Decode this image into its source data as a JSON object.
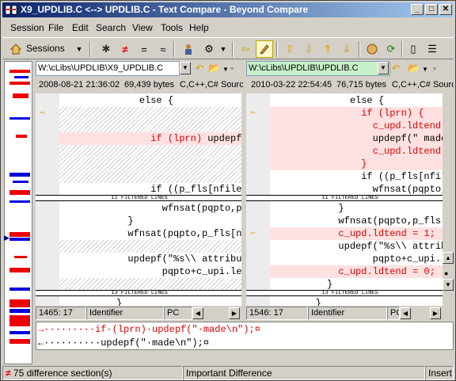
{
  "window": {
    "title": "X9_UPDLIB.C <--> UPDLIB.C - Text Compare - Beyond Compare",
    "minimize": "_",
    "maximize": "□",
    "close": "✕"
  },
  "menu": [
    "Session",
    "File",
    "Edit",
    "Search",
    "View",
    "Tools",
    "Help"
  ],
  "toolbar": {
    "sessions_label": "Sessions",
    "icons": [
      "home-icon",
      "all-icon",
      "diffs-icon",
      "same-icon",
      "context-icon",
      "rules-icon",
      "next-icon",
      "edit-icon",
      "prev-diff-icon",
      "next-diff-icon",
      "swap-icon",
      "reload-icon",
      "minor-icon",
      "report-icon"
    ]
  },
  "left": {
    "path": "W:\\cLibs\\UPDLIB\\X9_UPDLIB.C",
    "date": "2008-08-21 21:36:02",
    "size": "69,439 bytes",
    "format": "C,C++,C# Source",
    "lines": [
      {
        "text": "              else {",
        "style": ""
      },
      {
        "text": "",
        "style": "hatch"
      },
      {
        "text": "",
        "style": "hatch"
      },
      {
        "text": "                if (lprn) updepf(\" made\\n\");",
        "style": "pink"
      },
      {
        "text": "",
        "style": "hatch"
      },
      {
        "text": "",
        "style": "hatch"
      },
      {
        "text": "",
        "style": "hatch"
      },
      {
        "text": "                if ((p_fls[nfile].iattribute",
        "style": ""
      },
      {
        "text": "                  wfnsat(pqpto,p_fls[nfile].",
        "style": ""
      },
      {
        "text": "            }",
        "style": ""
      },
      {
        "text": "            wfnsat(pqpto,p_fls[nfile]",
        "style": ""
      },
      {
        "text": "",
        "style": "hatch"
      },
      {
        "text": "            updepf(\"%s\\\\ attribute",
        "style": ""
      },
      {
        "text": "                  pqpto+c_upi.len",
        "style": ""
      },
      {
        "text": "",
        "style": "hatch"
      },
      {
        "text": "          }",
        "style": ""
      },
      {
        "text": "        }",
        "style": ""
      }
    ],
    "filtered": [
      "11 FILTERED LINES",
      "13 FILTERED LINES"
    ],
    "status_pos": "1465: 17",
    "status_kind": "Identifier",
    "status_pc": "PC"
  },
  "right": {
    "path": "W:\\cLibs\\UPDLIB\\UPDLIB.C",
    "date": "2010-03-22 22:54:45",
    "size": "76,715 bytes",
    "format": "C,C++,C# Source",
    "lines": [
      {
        "text": "              else {",
        "style": ""
      },
      {
        "text": "                if (lprn) {",
        "style": "pinkred"
      },
      {
        "text": "                  c_upd.ldtend = 1;",
        "style": "pinkred"
      },
      {
        "text": "                  updepf(\" made\\n\");",
        "style": "pink"
      },
      {
        "text": "                  c_upd.ldtend = 0;",
        "style": "pinkred"
      },
      {
        "text": "                }",
        "style": "pinkred"
      },
      {
        "text": "                if ((p_fls[nfile].iattribute",
        "style": ""
      },
      {
        "text": "                  wfnsat(pqpto,p_fls[nfile].",
        "style": ""
      },
      {
        "text": "            }",
        "style": ""
      },
      {
        "text": "            wfnsat(pqpto,p_fls[nfile]",
        "style": ""
      },
      {
        "text": "            c_upd.ldtend = 1;",
        "style": "pinkred"
      },
      {
        "text": "            updepf(\"%s\\\\ attribute",
        "style": ""
      },
      {
        "text": "                  pqpto+c_upi.len",
        "style": ""
      },
      {
        "text": "            c_upd.ldtend = 0;",
        "style": "pinkred"
      },
      {
        "text": "          }",
        "style": ""
      },
      {
        "text": "        }",
        "style": ""
      }
    ],
    "filtered": [
      "11 FILTERED LINES",
      "13 FILTERED LINES"
    ],
    "status_pos": "1546: 17",
    "status_kind": "Identifier",
    "status_pc": "PC"
  },
  "compare": {
    "line1": "→·········if·(lprn)·updepf(\"·made\\n\");¤",
    "line2": "←··········updepf(\"·made\\n\");¤"
  },
  "statusbar": {
    "diffs": "75 difference section(s)",
    "importance": "Important Difference",
    "mode": "Insert"
  }
}
